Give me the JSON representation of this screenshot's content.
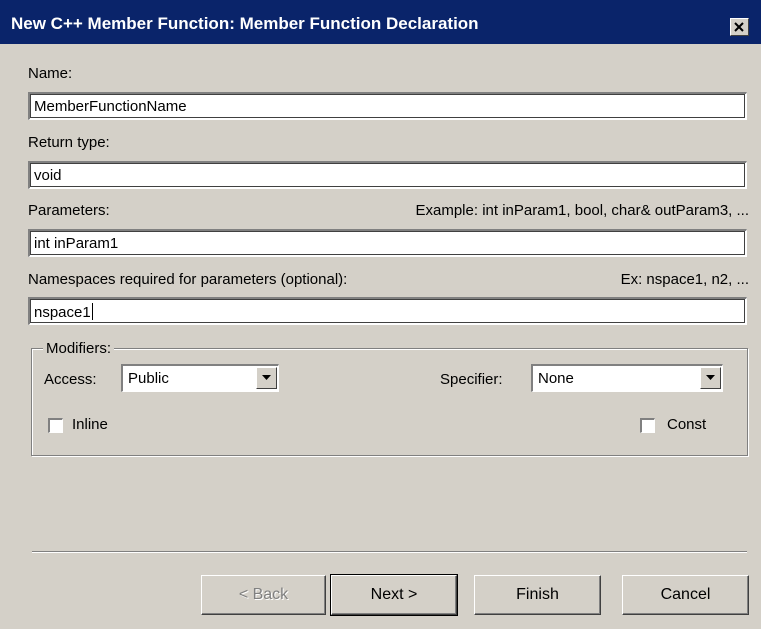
{
  "window": {
    "title": "New C++ Member Function: Member Function Declaration"
  },
  "name": {
    "label": "Name:",
    "value": "MemberFunctionName"
  },
  "return_type": {
    "label": "Return type:",
    "value": "void"
  },
  "parameters": {
    "label": "Parameters:",
    "example": "Example: int inParam1, bool, char& outParam3, ...",
    "value": "int inParam1"
  },
  "namespaces": {
    "label": "Namespaces required for parameters (optional):",
    "example": "Ex: nspace1, n2, ...",
    "value": "nspace1"
  },
  "modifiers": {
    "title": "Modifiers:",
    "access_label": "Access:",
    "access_value": "Public",
    "specifier_label": "Specifier:",
    "specifier_value": "None",
    "inline_label": "Inline",
    "inline_checked": false,
    "const_label": "Const",
    "const_checked": false
  },
  "buttons": {
    "back": "< Back",
    "next": "Next >",
    "finish": "Finish",
    "cancel": "Cancel"
  },
  "colors": {
    "titlebar": "#0a246a",
    "dialog_bg": "#d4d0c8"
  }
}
